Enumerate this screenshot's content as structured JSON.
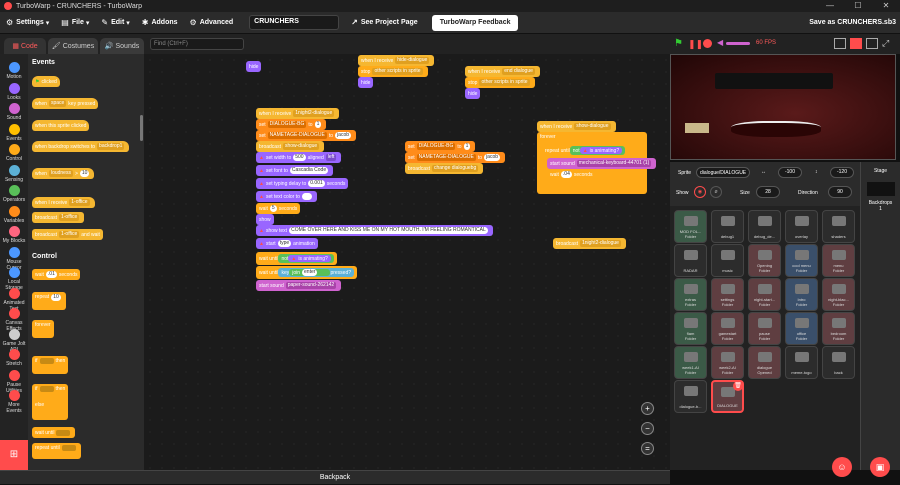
{
  "window": {
    "title": "TurboWarp - CRUNCHERS - TurboWarp",
    "minimize": "—",
    "maximize": "☐",
    "close": "✕"
  },
  "menubar": {
    "settings": "Settings",
    "file": "File",
    "edit": "Edit",
    "addons": "Addons",
    "advanced": "Advanced",
    "project_title": "CRUNCHERS",
    "see_project_page": "See Project Page",
    "feedback": "TurboWarp Feedback",
    "save_as": "Save as CRUNCHERS.sb3"
  },
  "tabs": {
    "code": "Code",
    "costumes": "Costumes",
    "sounds": "Sounds"
  },
  "find": {
    "placeholder": "Find (Ctrl+F)"
  },
  "categories": [
    {
      "label": "Motion",
      "color": "#4c97ff"
    },
    {
      "label": "Looks",
      "color": "#9966ff"
    },
    {
      "label": "Sound",
      "color": "#cf63cf"
    },
    {
      "label": "Events",
      "color": "#ffbf00"
    },
    {
      "label": "Control",
      "color": "#ffab19"
    },
    {
      "label": "Sensing",
      "color": "#5cb1d6"
    },
    {
      "label": "Operators",
      "color": "#59c059"
    },
    {
      "label": "Variables",
      "color": "#ff8c1a"
    },
    {
      "label": "My Blocks",
      "color": "#ff6680"
    },
    {
      "label": "Mouse Cursor",
      "color": "#4c97ff"
    },
    {
      "label": "Local Storage",
      "color": "#4c97ff"
    },
    {
      "label": "Animated Text",
      "color": "#ff4c4c"
    },
    {
      "label": "Canvas Effects",
      "color": "#ff4c4c"
    },
    {
      "label": "Game Jolt API",
      "color": "#ccc"
    },
    {
      "label": "Stretch",
      "color": "#ff4c4c"
    },
    {
      "label": "Pause Utilities",
      "color": "#ff4c4c"
    },
    {
      "label": "More Events",
      "color": "#ff4c4c"
    }
  ],
  "palette": {
    "events_heading": "Events",
    "control_heading": "Control",
    "b_clicked": "clicked",
    "b_when_key": "when",
    "b_space": "space",
    "b_key_pressed": "key pressed",
    "b_sprite_clicked": "when this sprite clicked",
    "b_backdrop": "when backdrop switches to",
    "b_backdrop_val": "backdrop1",
    "b_when2": "when",
    "b_loudness": "loudness",
    "b_gt": ">",
    "b_10": "10",
    "b_when_receive": "when I receive",
    "b_office": "1-office",
    "b_broadcast": "broadcast",
    "b_office2": "1-office",
    "b_broadcast2": "broadcast",
    "b_office3": "1-office",
    "b_and_wait": "and wait",
    "b_wait": "wait",
    "b_wait_val": ".01",
    "b_seconds": "seconds",
    "b_repeat": "repeat",
    "b_repeat_val": "10",
    "b_forever": "forever",
    "b_if": "if",
    "b_then": "then",
    "b_if2": "if",
    "b_then2": "then",
    "b_else": "else",
    "b_wait_until": "wait until",
    "b_repeat_until": "repeat until"
  },
  "scripts": {
    "s1_hide": "hide",
    "s2_when_receive": "when I receive",
    "s2_msg": "hide-dialogue",
    "s2_stop": "stop",
    "s2_stop_val": "other scripts in sprite",
    "s2_hide": "hide",
    "s3_when_receive": "when I receive",
    "s3_msg": "end dialogue",
    "s3_stop": "stop",
    "s3_stop_val": "other scripts in sprite",
    "s3_hide": "hide",
    "m_when_receive": "when I receive",
    "m_msg": "1night2-dialogue",
    "m_set1": "set",
    "m_set1_var": "DIALOGUE-BG",
    "m_to": "to",
    "m_set1_val": "1",
    "m_set2": "set",
    "m_set2_var": "NAMETAGE-DIALOGUE",
    "m_to2": "to",
    "m_set2_val": "jacob",
    "m_broadcast": "broadcast",
    "m_broadcast_val": "show-dialogue",
    "m_width": "set width to",
    "m_width_val": "500",
    "m_aligned": "aligned",
    "m_align_val": "left",
    "m_font": "set font to",
    "m_font_val": "Cascadia Code",
    "m_typing": "set typing delay to",
    "m_typing_val": "0.001",
    "m_seconds": "seconds",
    "m_color": "set text color to",
    "m_wait": "wait",
    "m_wait_val": "5",
    "m_seconds2": "seconds",
    "m_show": "show",
    "m_show_text": "show text",
    "m_text_val": "COME OVER HERE AND KISS ME ON MY HOT MOUTH. I'M FEELING ROMANTICAL",
    "m_start": "start",
    "m_start_val": "type",
    "m_animation": "animation",
    "m_wait_until": "wait until",
    "m_not": "not",
    "m_is_animating": "is animating?",
    "m_wait_until2": "wait until",
    "m_key": "key",
    "m_join": "join",
    "m_enter": "enter",
    "m_pressed": "pressed?",
    "m_start_sound": "start sound",
    "m_sound_val": "paper-sound-262142",
    "s5_set1": "set",
    "s5_var1": "DIALOGUE-BG",
    "s5_to1": "to",
    "s5_val1": "1",
    "s5_set2": "set",
    "s5_var2": "NAMETAGE-DIALOGUE",
    "s5_to2": "to",
    "s5_val2": "jacob",
    "s5_broadcast": "broadcast",
    "s5_broadcast_val": "change dialoguebg",
    "s6_when_receive": "when I receive",
    "s6_msg": "show-dialogue",
    "s6_forever": "forever",
    "s6_repeat_until": "repeat until",
    "s6_not": "not",
    "s6_is_animating": "is animating?",
    "s6_start_sound": "start sound",
    "s6_sound_val": "mechanical-keyboard-44701 (1)",
    "s6_wait": "wait",
    "s6_wait_val": ".04",
    "s6_seconds": "seconds",
    "s7_broadcast": "broadcast",
    "s7_broadcast_val": "1night2-dialogue"
  },
  "backpack": "Backpack",
  "stage_controls": {
    "fps": "60 FPS"
  },
  "sprite_info": {
    "sprite_label": "Sprite",
    "sprite_name": "dialogue/DIALOGUE",
    "x_val": "-100",
    "y_val": "-120",
    "show_label": "Show",
    "size_label": "Size",
    "size_val": "28",
    "direction_label": "Direction",
    "direction_val": "90"
  },
  "sprites": [
    {
      "name": "MOD FOL...",
      "sub": "Folder"
    },
    {
      "name": "debug1",
      "sub": ""
    },
    {
      "name": "debug_de...",
      "sub": ""
    },
    {
      "name": "overlay",
      "sub": ""
    },
    {
      "name": "shaders",
      "sub": ""
    },
    {
      "name": "RADAR",
      "sub": ""
    },
    {
      "name": "music",
      "sub": ""
    },
    {
      "name": "Opening",
      "sub": "Folder"
    },
    {
      "name": "cool menu",
      "sub": "Folder"
    },
    {
      "name": "menu",
      "sub": "Folder"
    },
    {
      "name": "extras",
      "sub": "Folder"
    },
    {
      "name": "settings",
      "sub": "Folder"
    },
    {
      "name": "night-start...",
      "sub": "Folder"
    },
    {
      "name": "Intro",
      "sub": "Folder"
    },
    {
      "name": "night-blac...",
      "sub": "Folder"
    },
    {
      "name": "flam",
      "sub": "Folder"
    },
    {
      "name": "gamestart",
      "sub": "Folder"
    },
    {
      "name": "pause",
      "sub": "Folder"
    },
    {
      "name": "office",
      "sub": "Folder"
    },
    {
      "name": "bedroom",
      "sub": "Folder"
    },
    {
      "name": "week1-AI",
      "sub": "Folder"
    },
    {
      "name": "week2-AI",
      "sub": "Folder"
    },
    {
      "name": "dialogue",
      "sub": "Opened"
    },
    {
      "name": "meme-togo",
      "sub": ""
    },
    {
      "name": "back",
      "sub": ""
    },
    {
      "name": "dialogue-b...",
      "sub": ""
    },
    {
      "name": "DIALOGUE",
      "sub": ""
    }
  ],
  "stage_col": {
    "label": "Stage",
    "backdrops_label": "Backdrops",
    "backdrops_count": "1"
  }
}
